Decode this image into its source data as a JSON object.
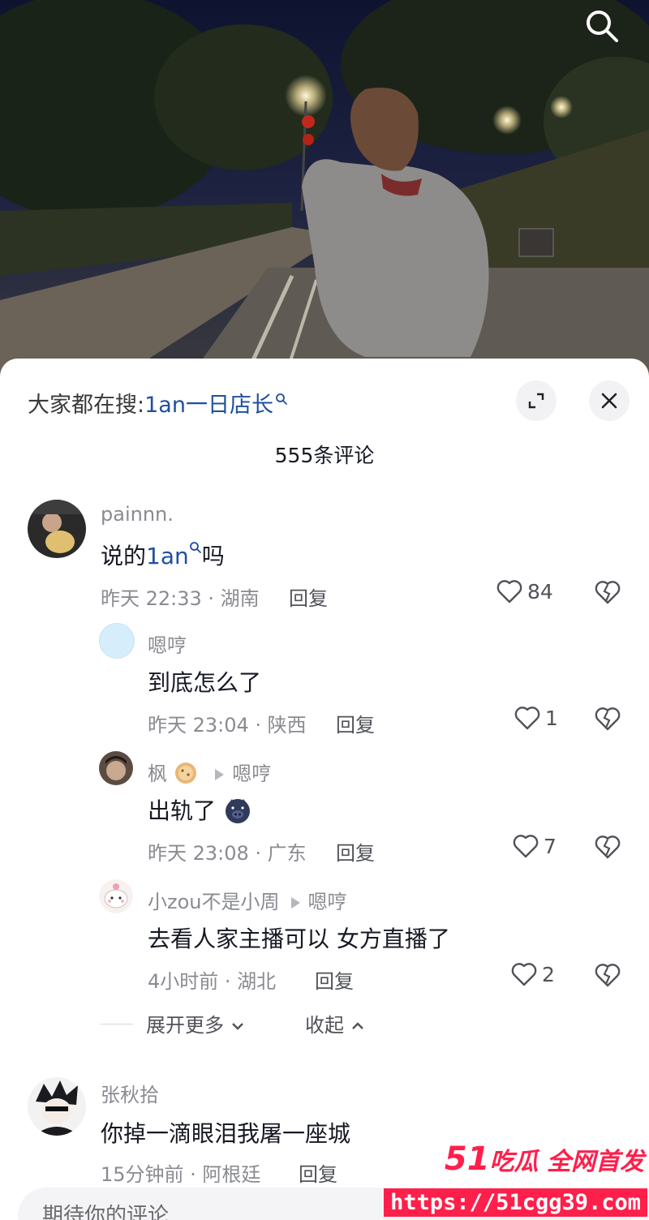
{
  "header": {
    "hot_search_prefix": "大家都在搜:",
    "hot_search_keyword": "1an一日店长",
    "comment_count": "555条评论"
  },
  "comments": [
    {
      "name": "painnn.",
      "text_before": "说的",
      "keyword": "1an",
      "text_after": "吗",
      "meta": "昨天 22:33 · 湖南",
      "reply_label": "回复",
      "likes": "84"
    },
    {
      "name": "嗯哼",
      "text": "到底怎么了",
      "meta": "昨天 23:04 · 陕西",
      "reply_label": "回复",
      "likes": "1"
    },
    {
      "name": "枫",
      "reply_to": "嗯哼",
      "text": "出轨了",
      "meta": "昨天 23:08 · 广东",
      "reply_label": "回复",
      "likes": "7"
    },
    {
      "name": "小zou不是小周",
      "reply_to": "嗯哼",
      "text": "去看人家主播可以 女方直播了",
      "meta": "4小时前 · 湖北",
      "reply_label": "回复",
      "likes": "2"
    },
    {
      "name": "张秋拾",
      "text": "你掉一滴眼泪我屠一座城",
      "meta": "15分钟前 · 阿根廷",
      "reply_label": "回复"
    }
  ],
  "thread_controls": {
    "expand_more": "展开更多",
    "collapse": "收起"
  },
  "input": {
    "placeholder": "期待你的评论"
  },
  "watermark": {
    "brand_number": "51",
    "brand_text": "吃瓜 全网首发",
    "url": "https://51cgg39.com"
  },
  "colors": {
    "keyword": "#1f4fa0",
    "watermark": "#ff1f4b",
    "meta": "#8a8b91"
  },
  "icons": [
    "search-icon",
    "expand-icon",
    "close-icon",
    "heart-icon",
    "broken-heart-icon",
    "chevron-down-icon",
    "chevron-up-icon",
    "pig-emoji-icon",
    "cookie-emoji-icon"
  ]
}
